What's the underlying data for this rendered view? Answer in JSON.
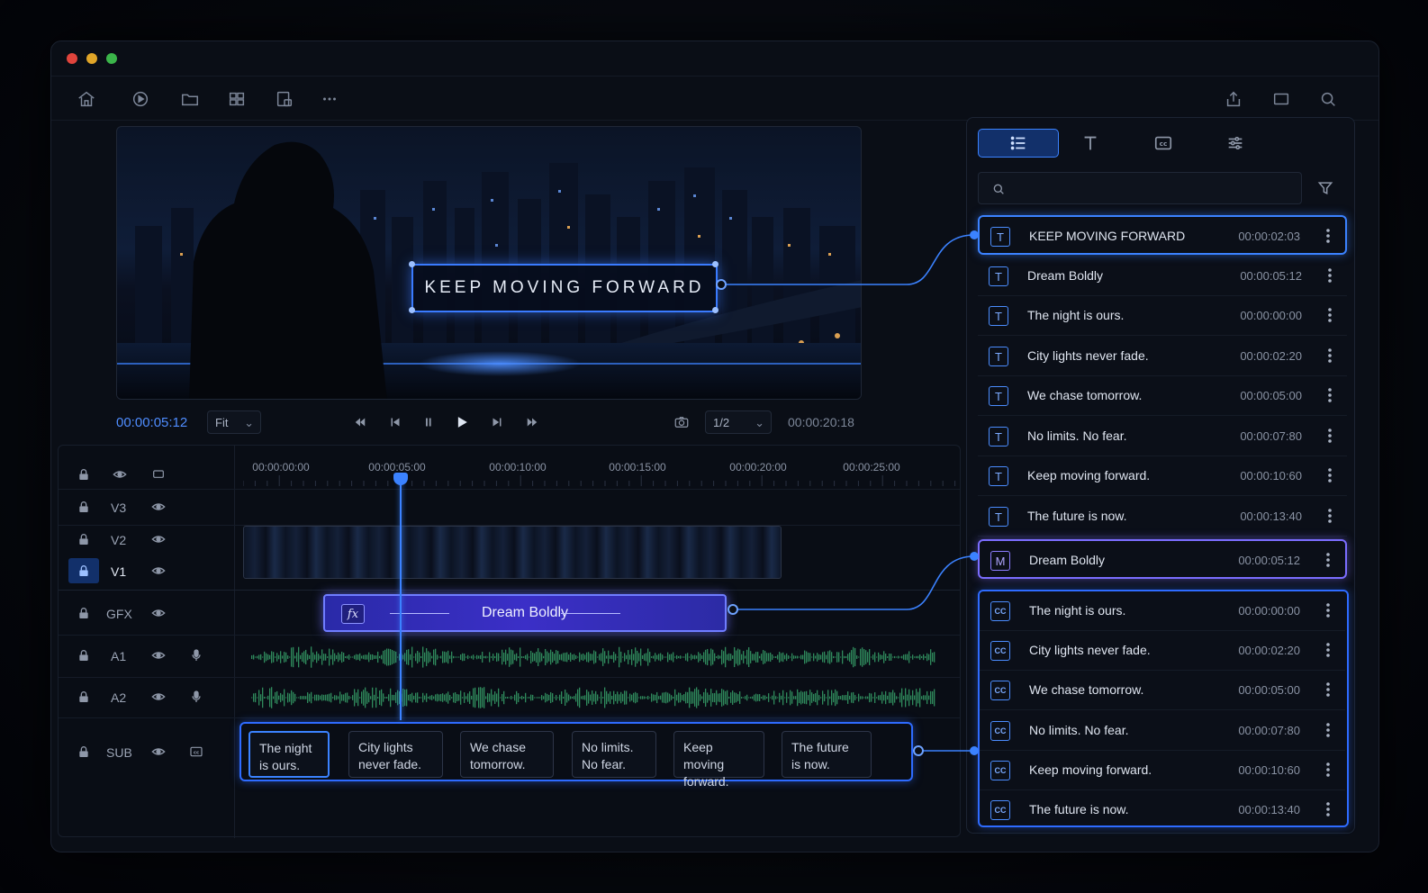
{
  "window": {
    "traffic_colors": [
      "#e0443c",
      "#e0a528",
      "#3bb54a"
    ]
  },
  "toolbar": {
    "left_icons": [
      "home-icon",
      "play-circle-icon",
      "folder-icon",
      "grid-icon",
      "export-doc-icon",
      "more-icon"
    ],
    "right_icons": [
      "share-icon",
      "window-icon",
      "search-icon"
    ]
  },
  "preview": {
    "overlay_text": "KEEP MOVING FORWARD"
  },
  "transport": {
    "current_time": "00:00:05:12",
    "zoom": "Fit",
    "quality": "1/2",
    "duration": "00:00:20:18"
  },
  "timeline": {
    "ruler": [
      "00:00:00:00",
      "00:00:05:00",
      "00:00:10:00",
      "00:00:15:00",
      "00:00:20:00",
      "00:00:25:00"
    ],
    "tracks": {
      "v3": "V3",
      "v2": "V2",
      "v1": "V1",
      "gfx": "GFX",
      "a1": "A1",
      "a2": "A2",
      "sub": "SUB"
    },
    "gfx_clip": {
      "fx": "fx",
      "label": "Dream Boldly"
    },
    "subtitles": [
      "The night\nis ours.",
      "City lights\nnever fade.",
      "We chase\ntomorrow.",
      "No limits.\nNo fear.",
      "Keep moving\nforward.",
      "The future\nis now."
    ]
  },
  "panel": {
    "tabs": [
      "list-icon",
      "text-icon",
      "cc-icon",
      "sliders-icon"
    ],
    "search_placeholder": "",
    "items": [
      {
        "icon": "T",
        "label": "KEEP MOVING FORWARD",
        "time": "00:00:02:03"
      },
      {
        "icon": "T",
        "label": "Dream Boldly",
        "time": "00:00:05:12"
      },
      {
        "icon": "T",
        "label": "The night is ours.",
        "time": "00:00:00:00"
      },
      {
        "icon": "T",
        "label": "City lights never fade.",
        "time": "00:00:02:20"
      },
      {
        "icon": "T",
        "label": "We chase tomorrow.",
        "time": "00:00:05:00"
      },
      {
        "icon": "T",
        "label": "No limits. No fear.",
        "time": "00:00:07:80"
      },
      {
        "icon": "T",
        "label": "Keep moving forward.",
        "time": "00:00:10:60"
      },
      {
        "icon": "T",
        "label": "The future is now.",
        "time": "00:00:13:40"
      },
      {
        "icon": "M",
        "label": "Dream Boldly",
        "time": "00:00:05:12"
      },
      {
        "icon": "CC",
        "label": "The night is ours.",
        "time": "00:00:00:00"
      },
      {
        "icon": "CC",
        "label": "City lights never fade.",
        "time": "00:00:02:20"
      },
      {
        "icon": "CC",
        "label": "We chase tomorrow.",
        "time": "00:00:05:00"
      },
      {
        "icon": "CC",
        "label": "No limits. No fear.",
        "time": "00:00:07:80"
      },
      {
        "icon": "CC",
        "label": "Keep moving forward.",
        "time": "00:00:10:60"
      },
      {
        "icon": "CC",
        "label": "The future is now.",
        "time": "00:00:13:40"
      }
    ]
  },
  "colors": {
    "accent": "#3b82ff",
    "purple": "#7b6dff",
    "waveform": "#2f8a5c"
  }
}
